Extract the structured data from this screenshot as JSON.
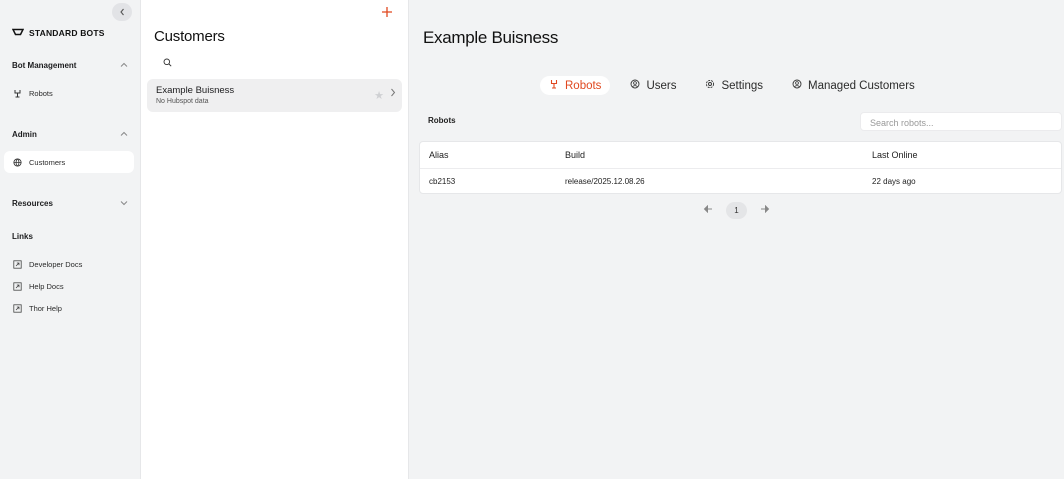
{
  "sidebar": {
    "brand": "STANDARD BOTS",
    "sections": {
      "bot_management": "Bot Management",
      "admin": "Admin",
      "resources": "Resources",
      "links": "Links"
    },
    "items": {
      "robots": "Robots",
      "customers": "Customers",
      "developer_docs": "Developer Docs",
      "help_docs": "Help Docs",
      "thor_help": "Thor Help"
    }
  },
  "customers_panel": {
    "title": "Customers",
    "search_placeholder": "",
    "items": [
      {
        "name": "Example Buisness",
        "subtitle": "No Hubspot data"
      }
    ]
  },
  "main": {
    "title": "Example Buisness",
    "tabs": [
      "Robots",
      "Users",
      "Settings",
      "Managed Customers"
    ],
    "active_tab": "Robots",
    "section_label": "Robots",
    "search_placeholder": "Search robots...",
    "table": {
      "headers": [
        "Alias",
        "Build",
        "Last Online"
      ],
      "rows": [
        [
          "cb2153",
          "release/2025.12.08.26",
          "22 days ago"
        ]
      ]
    },
    "pagination": {
      "current_page": "1"
    }
  },
  "colors": {
    "accent": "#e0481f",
    "background": "#f2f3f4",
    "panel": "#ffffff"
  },
  "icons": [
    "chevron-left-icon",
    "logo-icon",
    "robot-icon",
    "globe-icon",
    "external-link-icon",
    "plus-icon",
    "search-icon",
    "star-icon",
    "chevron-right-icon",
    "user-icon",
    "gear-icon",
    "arrow-left-icon",
    "arrow-right-icon"
  ]
}
